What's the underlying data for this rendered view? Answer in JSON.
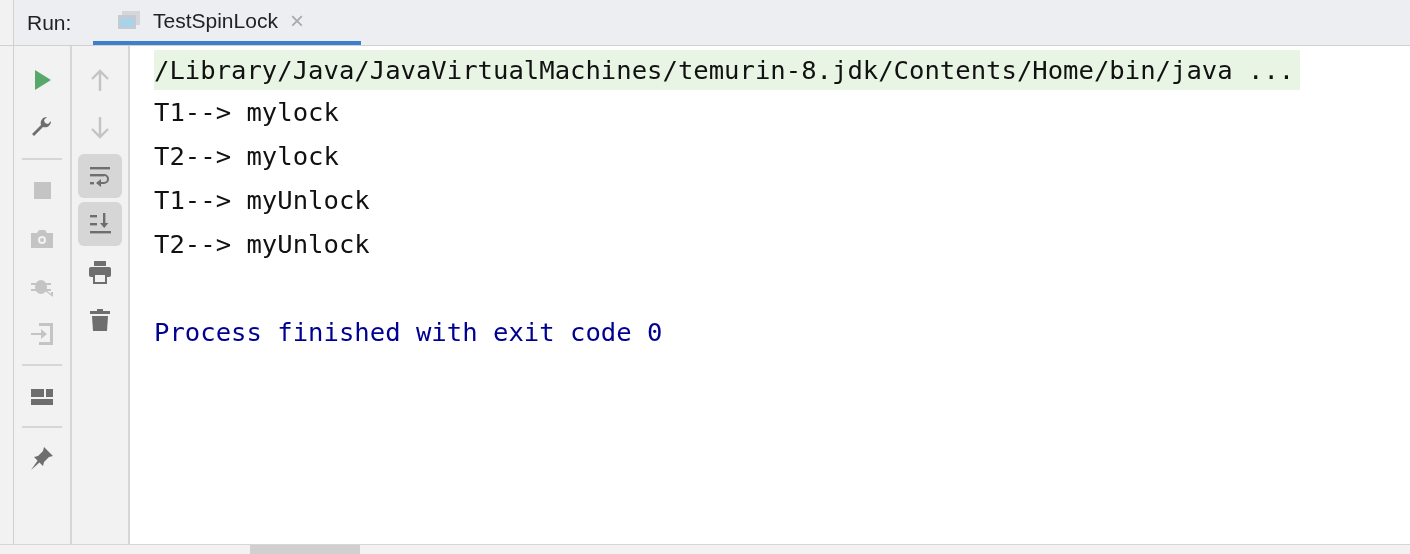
{
  "run_label": "Run:",
  "tabs": [
    {
      "title": "TestSpinLock",
      "selected": true,
      "close": "×"
    }
  ],
  "left_toolbar": [
    {
      "kind": "run",
      "disabled": false
    },
    {
      "kind": "wrench",
      "disabled": false
    },
    {
      "kind": "separator"
    },
    {
      "kind": "stop",
      "disabled": true
    },
    {
      "kind": "camera",
      "disabled": true
    },
    {
      "kind": "debug",
      "disabled": true
    },
    {
      "kind": "login",
      "disabled": true
    },
    {
      "kind": "separator"
    },
    {
      "kind": "layout",
      "disabled": false
    },
    {
      "kind": "separator"
    },
    {
      "kind": "pin",
      "disabled": false
    }
  ],
  "right_toolbar": [
    {
      "kind": "up",
      "disabled": true,
      "on": false
    },
    {
      "kind": "down",
      "disabled": true,
      "on": false
    },
    {
      "kind": "wrap",
      "disabled": false,
      "on": true
    },
    {
      "kind": "scroll-end",
      "disabled": false,
      "on": true
    },
    {
      "kind": "print",
      "disabled": false,
      "on": false
    },
    {
      "kind": "trash",
      "disabled": false,
      "on": false
    }
  ],
  "console": [
    {
      "kind": "command",
      "text": "/Library/Java/JavaVirtualMachines/temurin-8.jdk/Contents/Home/bin/java ..."
    },
    {
      "kind": "output",
      "text": "T1--> mylock"
    },
    {
      "kind": "output",
      "text": "T2--> mylock"
    },
    {
      "kind": "output",
      "text": "T1--> myUnlock"
    },
    {
      "kind": "output",
      "text": "T2--> myUnlock"
    },
    {
      "kind": "exit",
      "text": "Process finished with exit code 0"
    }
  ]
}
